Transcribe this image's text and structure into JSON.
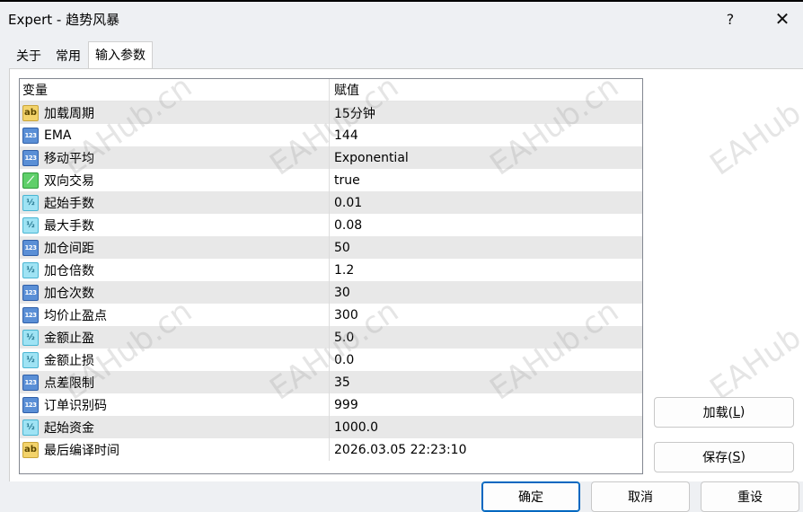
{
  "window": {
    "title": "Expert - 趋势风暴",
    "help_label": "?",
    "close_label": "✕"
  },
  "tabs": [
    {
      "label": "关于"
    },
    {
      "label": "常用"
    },
    {
      "label": "输入参数",
      "active": true
    }
  ],
  "grid": {
    "headers": {
      "variable": "变量",
      "value": "赋值"
    },
    "rows": [
      {
        "icon": "string-icon",
        "name": "加载周期",
        "value": "15分钟"
      },
      {
        "icon": "integer-icon",
        "name": "EMA",
        "value": "144"
      },
      {
        "icon": "integer-icon",
        "name": "移动平均",
        "value": "Exponential"
      },
      {
        "icon": "bool-icon",
        "name": "双向交易",
        "value": "true"
      },
      {
        "icon": "double-icon",
        "name": "起始手数",
        "value": "0.01"
      },
      {
        "icon": "double-icon",
        "name": "最大手数",
        "value": "0.08"
      },
      {
        "icon": "integer-icon",
        "name": "加仓间距",
        "value": "50"
      },
      {
        "icon": "double-icon",
        "name": "加仓倍数",
        "value": "1.2"
      },
      {
        "icon": "integer-icon",
        "name": "加仓次数",
        "value": "30"
      },
      {
        "icon": "integer-icon",
        "name": "均价止盈点",
        "value": "300"
      },
      {
        "icon": "double-icon",
        "name": "金额止盈",
        "value": "5.0"
      },
      {
        "icon": "double-icon",
        "name": "金额止损",
        "value": "0.0"
      },
      {
        "icon": "integer-icon",
        "name": "点差限制",
        "value": "35"
      },
      {
        "icon": "integer-icon",
        "name": "订单识别码",
        "value": "999"
      },
      {
        "icon": "double-icon",
        "name": "起始资金",
        "value": "1000.0"
      },
      {
        "icon": "string-icon",
        "name": "最后编译时间",
        "value": "2026.03.05 22:23:10"
      }
    ]
  },
  "icon_glyphs": {
    "string-icon": "ab",
    "integer-icon": "123",
    "double-icon": "½",
    "bool-icon": "⟋"
  },
  "side_buttons": {
    "load": {
      "text": "加载(",
      "key": "L",
      "end": ")"
    },
    "save": {
      "text": "保存(",
      "key": "S",
      "end": ")"
    }
  },
  "footer_buttons": {
    "ok": "确定",
    "cancel": "取消",
    "reset": "重设"
  },
  "watermark_text": "EAHub.cn",
  "colors": {
    "alt_row": "#e8e8e8",
    "primary_border": "#0067c0"
  }
}
